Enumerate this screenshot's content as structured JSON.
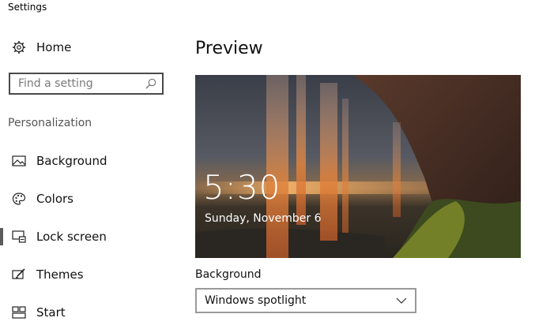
{
  "window": {
    "title": "Settings"
  },
  "sidebar": {
    "home_label": "Home",
    "search": {
      "placeholder": "Find a setting",
      "value": ""
    },
    "section_label": "Personalization",
    "items": [
      {
        "label": "Background",
        "icon": "picture-icon"
      },
      {
        "label": "Colors",
        "icon": "palette-icon"
      },
      {
        "label": "Lock screen",
        "icon": "lock-screen-icon",
        "selected": true
      },
      {
        "label": "Themes",
        "icon": "brush-icon"
      },
      {
        "label": "Start",
        "icon": "start-grid-icon"
      }
    ]
  },
  "main": {
    "title": "Preview",
    "lockscreen": {
      "time": "5:30",
      "date": "Sunday, November 6"
    },
    "background_field": {
      "label": "Background",
      "selected": "Windows spotlight"
    }
  }
}
